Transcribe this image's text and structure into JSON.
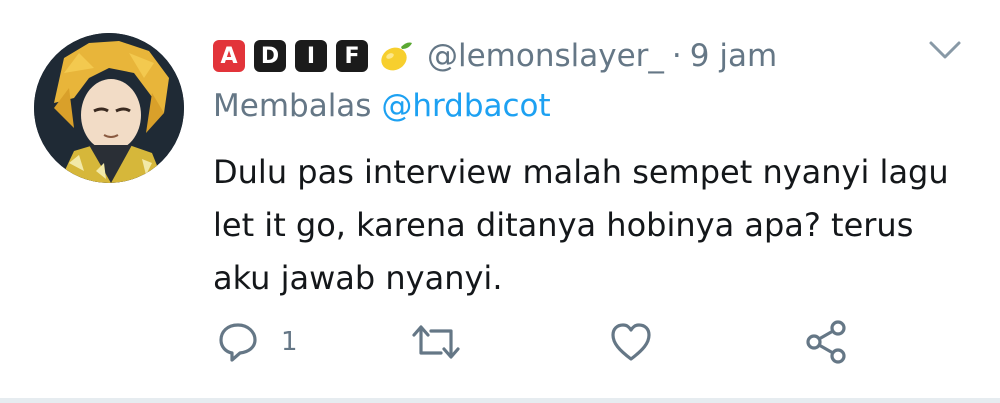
{
  "tweet": {
    "badges": [
      "A",
      "D",
      "I",
      "F"
    ],
    "handle": "@lemonslayer_",
    "separator": "·",
    "time": "9 jam",
    "replying_prefix": "Membalas",
    "replying_to": "@hrdbacot",
    "text_lines": [
      "Dulu pas interview malah sempet nyanyi lagu",
      "let it go, karena ditanya hobinya apa? terus",
      "aku jawab nyanyi."
    ],
    "reply_count": "1"
  },
  "icons": {
    "avatar": "profile-avatar",
    "badge_emoji": "lemon-icon",
    "menu": "chevron-down-icon",
    "reply": "reply-icon",
    "retweet": "retweet-icon",
    "like": "heart-icon",
    "share": "share-icon"
  },
  "colors": {
    "muted": "#657786",
    "link": "#1da1f2",
    "text": "#14171a",
    "badge_red": "#e2343a",
    "badge_dark": "#1b1b1b"
  }
}
